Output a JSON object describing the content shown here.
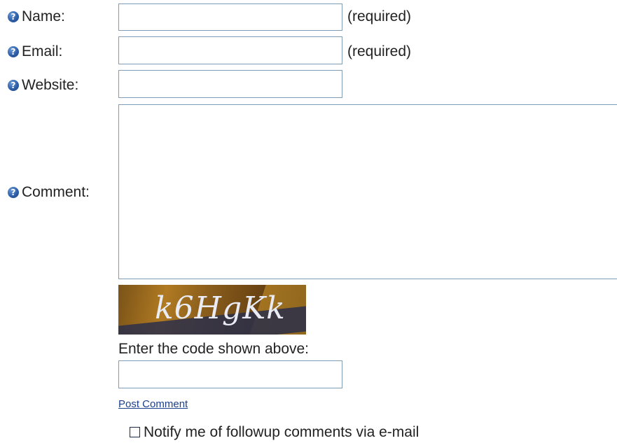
{
  "form": {
    "name": {
      "label": "Name:",
      "value": "",
      "note": "(required)",
      "icon": "help-icon"
    },
    "email": {
      "label": "Email:",
      "value": "",
      "note": "(required)",
      "icon": "help-icon"
    },
    "website": {
      "label": "Website:",
      "value": "",
      "icon": "help-icon"
    },
    "comment": {
      "label": "Comment:",
      "value": "",
      "icon": "help-icon"
    },
    "captcha": {
      "code": "k6HgKk",
      "prompt": "Enter the code shown above:",
      "value": ""
    },
    "post_link": "Post Comment",
    "notify": {
      "label": "Notify me of followup comments via e-mail",
      "checked": false
    }
  },
  "colors": {
    "field_border": "#7f9db9",
    "link": "#1c3f8c",
    "help_icon": "#2f5fa8"
  }
}
